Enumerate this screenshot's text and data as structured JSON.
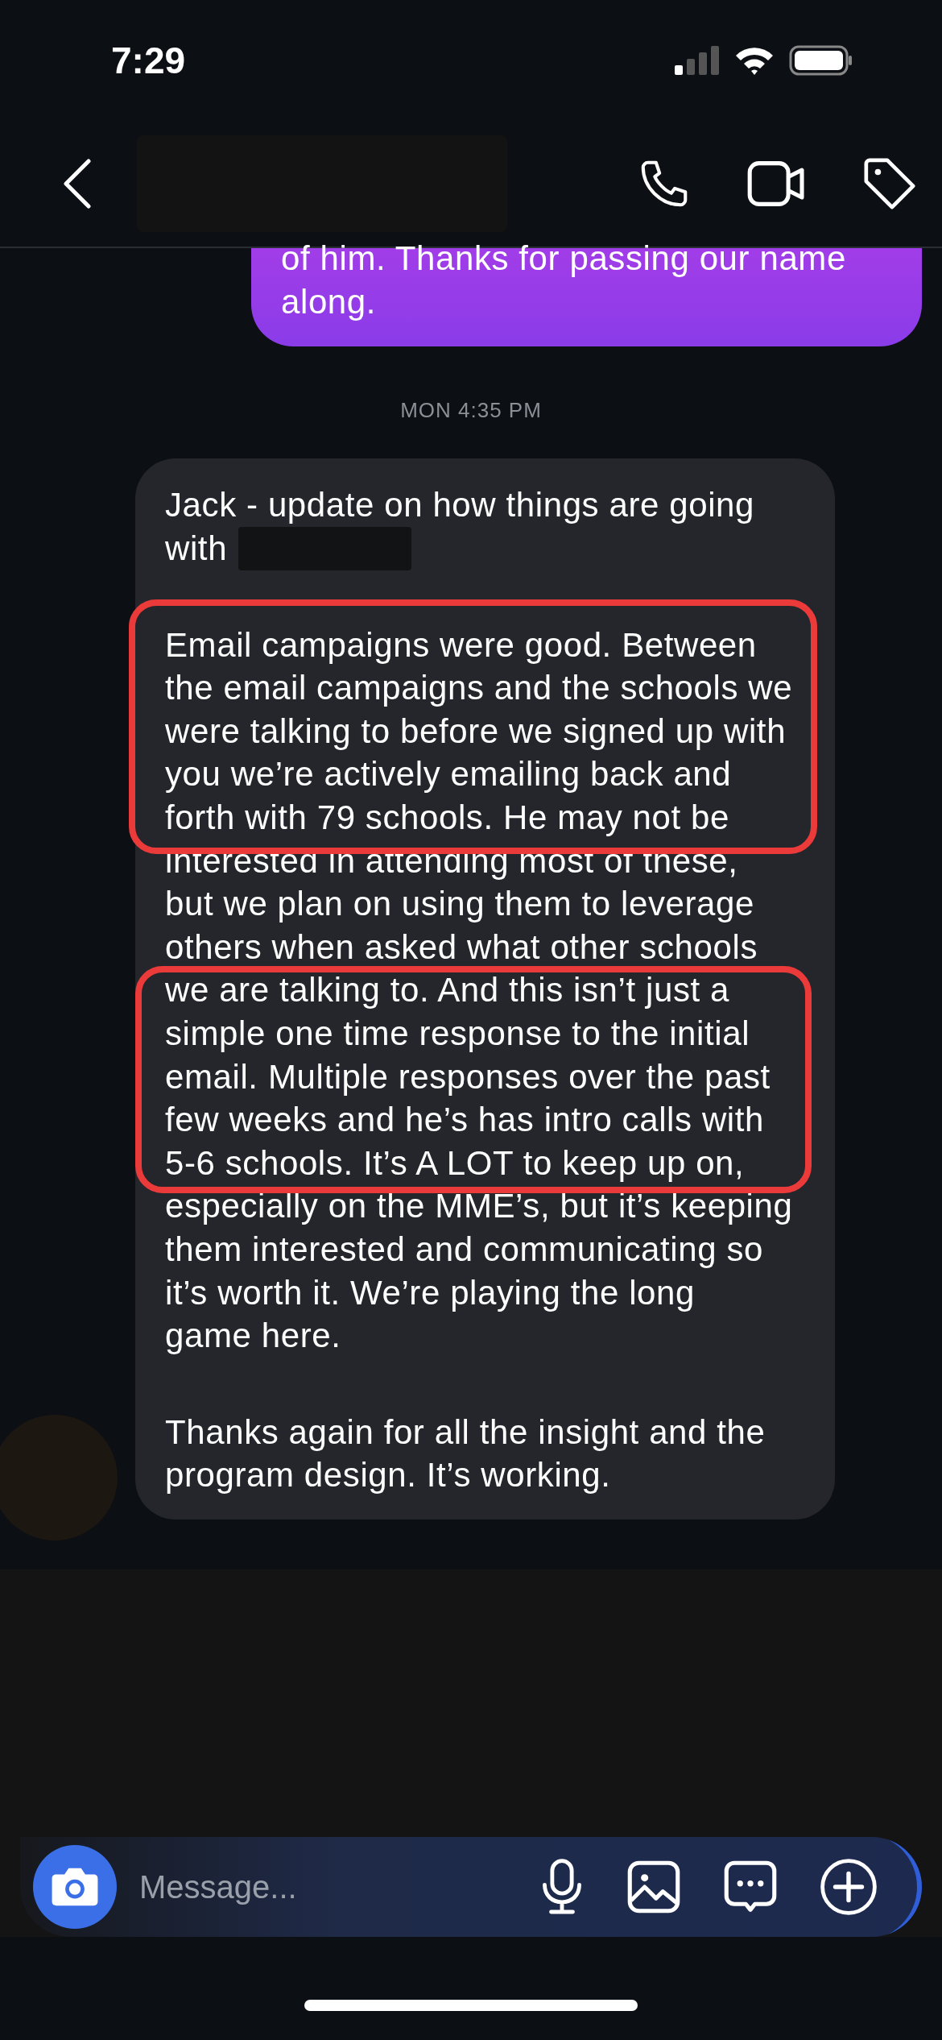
{
  "status_bar": {
    "time": "7:29"
  },
  "header": {
    "name_redacted": true
  },
  "messages": [
    {
      "kind": "sent",
      "paragraphs": [
        {
          "segments": [
            [
              {
                "text": "of him. Thanks for passing our name"
              },
              {
                "text": "along."
              }
            ]
          ]
        }
      ]
    },
    {
      "kind": "timestamp",
      "text": "MON 4:35 PM"
    },
    {
      "kind": "received",
      "paragraphs": [
        {
          "segments": [
            [
              {
                "text": "Jack - update on how things are going"
              },
              {
                "text": "with",
                "redacted": true
              }
            ]
          ]
        },
        {
          "segments": [
            [
              {
                "text": "Email campaigns were good. Between"
              },
              {
                "text": "the email campaigns and the schools we"
              },
              {
                "text": "were talking to before we signed up with"
              },
              {
                "text": "you we’re actively emailing back and"
              },
              {
                "text": "forth with 79 schools. He may not be"
              },
              {
                "text": "interested in attending most of these,"
              },
              {
                "text": "but we plan on using them to leverage"
              },
              {
                "text": "others when asked what other schools"
              },
              {
                "text": "we are talking to. And this isn’t just a"
              },
              {
                "text": "simple one time response to the initial"
              },
              {
                "text": "email. Multiple responses over the past"
              },
              {
                "text": "few weeks and he’s has intro calls with"
              },
              {
                "text": "5-6 schools. It’s A LOT to keep up on,"
              },
              {
                "text": "especially on the MME’s, but it’s keeping"
              },
              {
                "text": "them interested and communicating so"
              },
              {
                "text": "it’s worth it. We’re playing the long"
              },
              {
                "text": "game here."
              }
            ]
          ]
        },
        {
          "segments": [
            [
              {
                "text": "Thanks again for all the insight and the"
              },
              {
                "text": "program design. It’s working."
              }
            ]
          ]
        }
      ]
    }
  ],
  "composer": {
    "placeholder": "Message..."
  }
}
